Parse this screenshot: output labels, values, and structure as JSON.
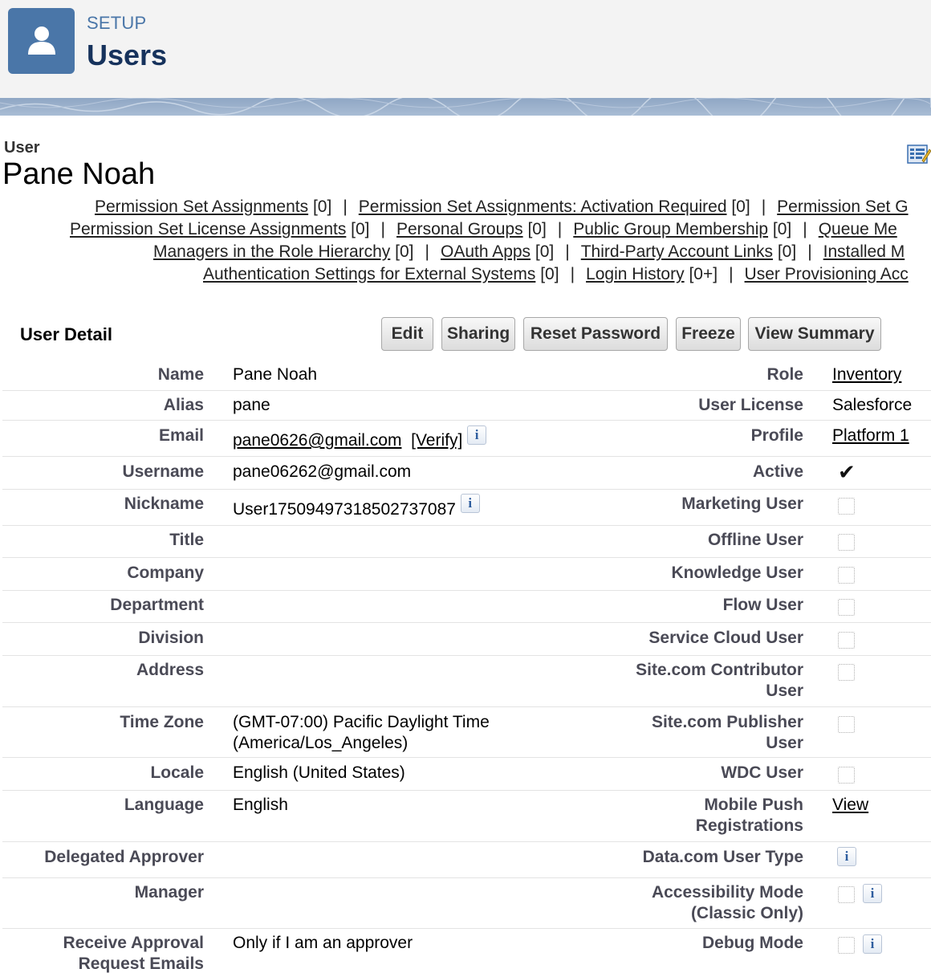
{
  "header": {
    "setup_label": "SETUP",
    "title": "Users",
    "icon": "user-icon"
  },
  "user": {
    "type_label": "User",
    "name": "Pane Noah"
  },
  "related_links": {
    "line1": [
      {
        "text": "Permission Set Assignments",
        "count": "[0]"
      },
      {
        "text": "Permission Set Assignments: Activation Required",
        "count": "[0]"
      },
      {
        "text": "Permission Set G"
      }
    ],
    "line2": [
      {
        "text": "Permission Set License Assignments",
        "count": "[0]"
      },
      {
        "text": "Personal Groups",
        "count": "[0]"
      },
      {
        "text": "Public Group Membership",
        "count": "[0]"
      },
      {
        "text": "Queue Me"
      }
    ],
    "line3": [
      {
        "text": "Managers in the Role Hierarchy",
        "count": "[0]"
      },
      {
        "text": "OAuth Apps",
        "count": "[0]"
      },
      {
        "text": "Third-Party Account Links",
        "count": "[0]"
      },
      {
        "text": "Installed M"
      }
    ],
    "line4": [
      {
        "text": "Authentication Settings for External Systems",
        "count": "[0]"
      },
      {
        "text": "Login History",
        "count": "[0+]"
      },
      {
        "text": "User Provisioning Acc"
      }
    ],
    "separator": "|"
  },
  "detail": {
    "section_title": "User Detail",
    "buttons": {
      "edit": "Edit",
      "sharing": "Sharing",
      "reset_password": "Reset Password",
      "freeze": "Freeze",
      "view_summary": "View Summary"
    },
    "left": {
      "name": {
        "label": "Name",
        "value": "Pane Noah"
      },
      "alias": {
        "label": "Alias",
        "value": "pane"
      },
      "email": {
        "label": "Email",
        "value": "pane0626@gmail.com",
        "verify": "[Verify]"
      },
      "username": {
        "label": "Username",
        "value": "pane06262@gmail.com"
      },
      "nickname": {
        "label": "Nickname",
        "value": "User17509497318502737087"
      },
      "title": {
        "label": "Title",
        "value": ""
      },
      "company": {
        "label": "Company",
        "value": ""
      },
      "department": {
        "label": "Department",
        "value": ""
      },
      "division": {
        "label": "Division",
        "value": ""
      },
      "address": {
        "label": "Address",
        "value": ""
      },
      "time_zone": {
        "label": "Time Zone",
        "value_line1": "(GMT-07:00) Pacific Daylight Time",
        "value_line2": "(America/Los_Angeles)"
      },
      "locale": {
        "label": "Locale",
        "value": "English (United States)"
      },
      "language": {
        "label": "Language",
        "value": "English"
      },
      "delegated_approver": {
        "label": "Delegated Approver",
        "value": ""
      },
      "manager": {
        "label": "Manager",
        "value": ""
      },
      "approval_emails": {
        "label_line1": "Receive Approval",
        "label_line2": "Request Emails",
        "value": "Only if I am an approver"
      }
    },
    "right": {
      "role": {
        "label": "Role",
        "value": "Inventory"
      },
      "user_license": {
        "label": "User License",
        "value": "Salesforce"
      },
      "profile": {
        "label": "Profile",
        "value": "Platform 1"
      },
      "active": {
        "label": "Active",
        "checked": true
      },
      "marketing_user": {
        "label": "Marketing User",
        "checked": false
      },
      "offline_user": {
        "label": "Offline User",
        "checked": false
      },
      "knowledge_user": {
        "label": "Knowledge User",
        "checked": false
      },
      "flow_user": {
        "label": "Flow User",
        "checked": false
      },
      "service_cloud_user": {
        "label": "Service Cloud User",
        "checked": false
      },
      "site_contributor": {
        "label_line1": "Site.com Contributor",
        "label_line2": "User",
        "checked": false
      },
      "site_publisher": {
        "label_line1": "Site.com Publisher",
        "label_line2": "User",
        "checked": false
      },
      "wdc_user": {
        "label": "WDC User",
        "checked": false
      },
      "mobile_push": {
        "label_line1": "Mobile Push",
        "label_line2": "Registrations",
        "value": "View"
      },
      "datacom_user_type": {
        "label": "Data.com User Type"
      },
      "accessibility_mode": {
        "label_line1": "Accessibility Mode",
        "label_line2": "(Classic Only)",
        "checked": false
      },
      "debug_mode": {
        "label": "Debug Mode",
        "checked": false
      }
    },
    "info_glyph": "i",
    "check_glyph": "✔"
  },
  "colors": {
    "header_bg": "#f3f3f3",
    "brand_blue": "#4a76a8",
    "title_navy": "#16325c",
    "label_gray": "#4a4a56"
  }
}
